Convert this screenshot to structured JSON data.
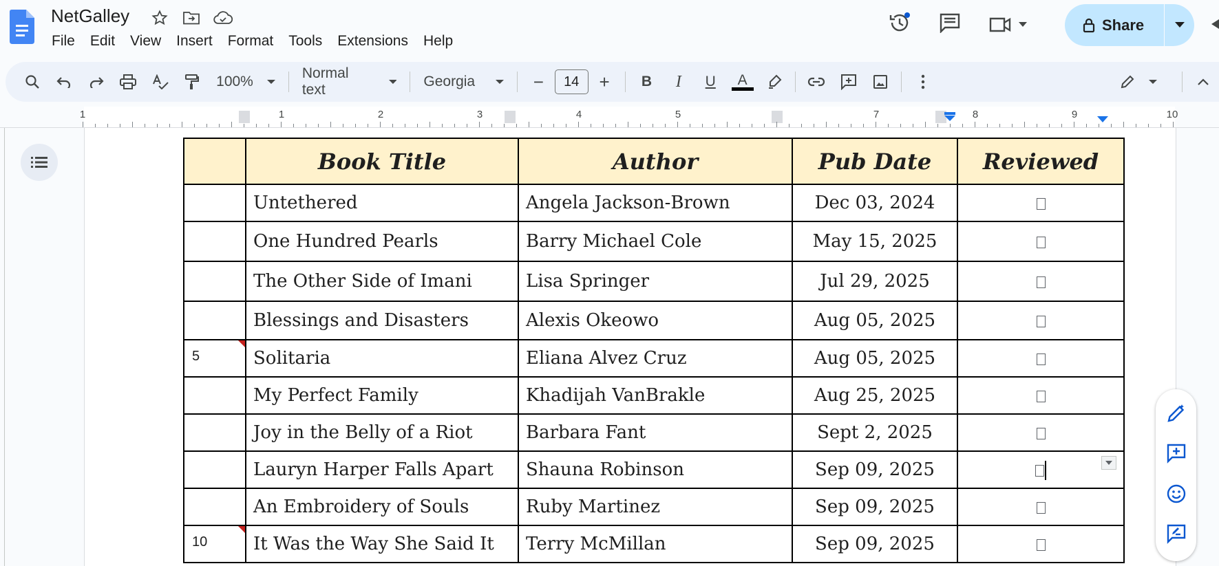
{
  "app": {
    "doc_title": "NetGalley",
    "menu": [
      "File",
      "Edit",
      "View",
      "Insert",
      "Format",
      "Tools",
      "Extensions",
      "Help"
    ],
    "share_label": "Share"
  },
  "toolbar": {
    "zoom": "100%",
    "style": "Normal text",
    "font": "Georgia",
    "font_size": "14",
    "minus": "−",
    "plus": "+",
    "bold": "B",
    "italic": "I",
    "underline": "U",
    "text_color": "A"
  },
  "ruler": {
    "labels": [
      "1",
      "1",
      "2",
      "3",
      "4",
      "5",
      "6",
      "7",
      "8",
      "9",
      "10"
    ]
  },
  "table": {
    "headers": [
      "",
      "Book Title",
      "Author",
      "Pub Date",
      "Reviewed"
    ],
    "rows": [
      {
        "num": "",
        "title": "Untethered",
        "author": "Angela Jackson-Brown",
        "date": "Dec 03, 2024"
      },
      {
        "num": "",
        "title": "One Hundred Pearls",
        "author": "Barry Michael Cole",
        "date": "May 15, 2025"
      },
      {
        "num": "",
        "title": "The Other Side of Imani",
        "author": "Lisa Springer",
        "date": "Jul 29, 2025"
      },
      {
        "num": "",
        "title": "Blessings and Disasters",
        "author": "Alexis Okeowo",
        "date": "Aug 05, 2025"
      },
      {
        "num": "5",
        "title": "Solitaria",
        "author": "Eliana Alvez Cruz",
        "date": "Aug 05, 2025"
      },
      {
        "num": "",
        "title": "My Perfect Family",
        "author": "Khadijah VanBrakle",
        "date": "Aug 25, 2025"
      },
      {
        "num": "",
        "title": "Joy in the Belly of a Riot",
        "author": "Barbara Fant",
        "date": "Sept 2, 2025"
      },
      {
        "num": "",
        "title": "Lauryn Harper Falls Apart",
        "author": "Shauna Robinson",
        "date": "Sep 09, 2025"
      },
      {
        "num": "",
        "title": "An Embroidery of Souls",
        "author": "Ruby Martinez",
        "date": "Sep 09, 2025"
      },
      {
        "num": "10",
        "title": "It Was the Way She Said It",
        "author": "Terry McMillan",
        "date": "Sep 09, 2025"
      }
    ]
  },
  "colors": {
    "header_fill": "#fff2cc",
    "share_bg": "#c2e7ff",
    "docs_blue": "#4285f4",
    "accent": "#0b57d0"
  }
}
